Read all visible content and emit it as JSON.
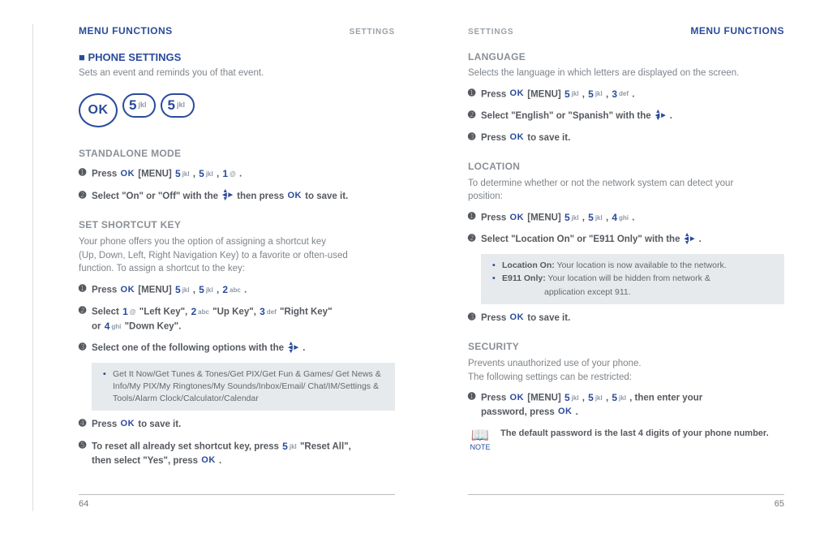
{
  "left": {
    "header_main": "MENU FUNCTIONS",
    "header_sub": "SETTINGS",
    "phone_settings_title": "PHONE SETTINGS",
    "phone_settings_sub": "Sets an event and reminds you of that event.",
    "standalone_title": "STANDALONE MODE",
    "standalone_step1_a": "Press ",
    "standalone_step1_b": " [MENU] ",
    "standalone_step1_c": " , ",
    "standalone_step1_d": " , ",
    "standalone_step1_e": " .",
    "standalone_step2_a": "Select \"On\" or \"Off\" with the ",
    "standalone_step2_b": " then press ",
    "standalone_step2_c": " to save it.",
    "shortcut_title": "SET SHORTCUT KEY",
    "shortcut_desc1": "Your phone offers you the option of assigning a shortcut key",
    "shortcut_desc2": "(Up, Down, Left, Right Navigation Key) to a favorite or often-used",
    "shortcut_desc3": "function. To assign a shortcut to the key:",
    "shortcut_step1_a": "Press ",
    "shortcut_step1_b": " [MENU] ",
    "shortcut_step2_a": "Select ",
    "shortcut_step2_left": " \"Left Key\", ",
    "shortcut_step2_up": " \"Up Key\", ",
    "shortcut_step2_right": " \"Right Key\"",
    "shortcut_step2_or": "or ",
    "shortcut_step2_down": " \"Down Key\".",
    "shortcut_step3_a": "Select one of the following options with the ",
    "shortcut_step3_b": " .",
    "shortcut_callout": "Get It Now/Get Tunes & Tones/Get PIX/Get Fun & Games/ Get News & Info/My PIX/My Ringtones/My Sounds/Inbox/Email/ Chat/IM/Settings & Tools/Alarm Clock/Calculator/Calendar",
    "shortcut_step4_a": "Press ",
    "shortcut_step4_b": " to save it.",
    "shortcut_step5_a": "To reset all already set shortcut key, press ",
    "shortcut_step5_b": " \"Reset All\",",
    "shortcut_step5_c": "then select \"Yes\", press ",
    "shortcut_step5_d": " .",
    "page_num": "64"
  },
  "right": {
    "header_sub": "SETTINGS",
    "header_main": "MENU FUNCTIONS",
    "language_title": "LANGUAGE",
    "language_sub": "Selects the language in which letters are displayed on the screen.",
    "lang_step1_a": "Press ",
    "lang_step1_b": " [MENU] ",
    "lang_step2_a": "Select \"English\" or \"Spanish\" with the ",
    "lang_step2_b": " .",
    "lang_step3_a": "Press ",
    "lang_step3_b": " to save it.",
    "location_title": "LOCATION",
    "location_sub1": "To determine whether or not the network system can detect your",
    "location_sub2": "position:",
    "loc_step1_a": "Press ",
    "loc_step1_b": " [MENU] ",
    "loc_step2_a": "Select \"Location On\" or \"E911 Only\" with the ",
    "loc_step2_b": " .",
    "loc_callout_on_label": "Location On:",
    "loc_callout_on_text": " Your location is now available to the network.",
    "loc_callout_e911_label": "E911 Only:",
    "loc_callout_e911_text1": " Your location will be hidden from network &",
    "loc_callout_e911_text2": "application except 911.",
    "loc_step3_a": "Press ",
    "loc_step3_b": " to save it.",
    "security_title": "SECURITY",
    "security_sub1": "Prevents unauthorized use of your phone.",
    "security_sub2": "The following settings can be restricted:",
    "sec_step1_a": "Press ",
    "sec_step1_b": " [MENU] ",
    "sec_step1_c": " , then enter your",
    "sec_step1_d": "password, press ",
    "sec_step1_e": " .",
    "note_label": "NOTE",
    "note_text": "The default password is the last 4 digits of your phone number.",
    "page_num": "65"
  },
  "keys": {
    "ok": "OK",
    "k1": "1",
    "k1s": "@",
    "k2": "2",
    "k2s": "abc",
    "k3": "3",
    "k3s": "def",
    "k4": "4",
    "k4s": "ghi",
    "k5": "5",
    "k5s": "jkl"
  },
  "bullets": {
    "n1": "➊",
    "n2": "➋",
    "n3": "➌",
    "n4": "➍",
    "n5": "➎"
  }
}
